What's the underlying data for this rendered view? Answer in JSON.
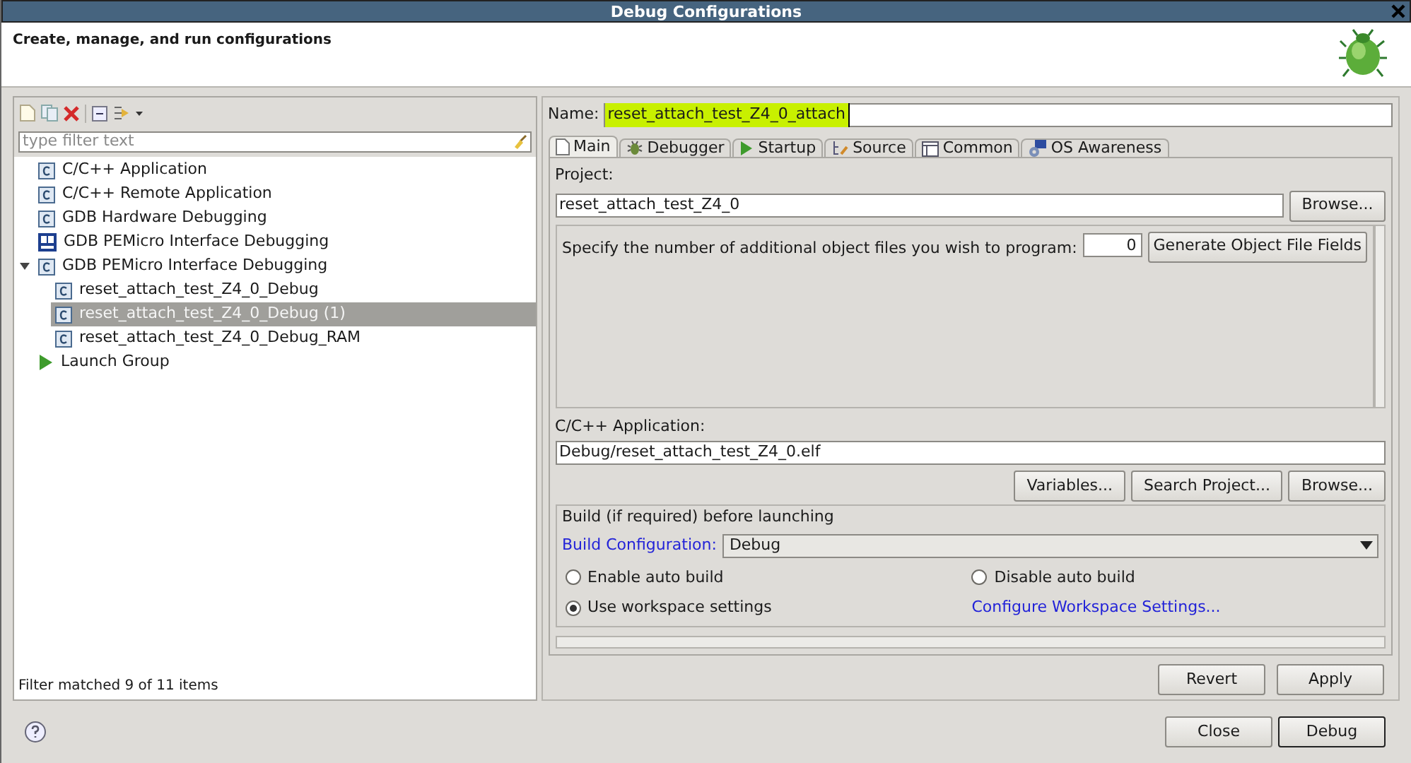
{
  "window": {
    "title": "Debug Configurations"
  },
  "header": {
    "title": "Create, manage, and run configurations"
  },
  "filter": {
    "placeholder": "type filter text"
  },
  "tree": [
    {
      "label": "C/C++ Application",
      "kind": "c",
      "selected": false
    },
    {
      "label": "C/C++ Remote Application",
      "kind": "c",
      "selected": false
    },
    {
      "label": "GDB Hardware Debugging",
      "kind": "c",
      "selected": false
    },
    {
      "label": "GDB PEMicro Interface Debugging",
      "kind": "pe",
      "selected": false
    },
    {
      "label": "GDB PEMicro Interface Debugging",
      "kind": "c",
      "selected": false,
      "expanded": true,
      "children": [
        {
          "label": "reset_attach_test_Z4_0_Debug",
          "kind": "c",
          "selected": false
        },
        {
          "label": "reset_attach_test_Z4_0_Debug (1)",
          "kind": "c",
          "selected": true
        },
        {
          "label": "reset_attach_test_Z4_0_Debug_RAM",
          "kind": "c",
          "selected": false
        }
      ]
    },
    {
      "label": "Launch Group",
      "kind": "launch",
      "selected": false
    }
  ],
  "filter_status": "Filter matched 9 of 11 items",
  "name": {
    "label": "Name:",
    "value": "reset_attach_test_Z4_0_attach"
  },
  "tabs": [
    {
      "label": "Main",
      "kind": "main",
      "selected": true
    },
    {
      "label": "Debugger",
      "kind": "debugger",
      "selected": false
    },
    {
      "label": "Startup",
      "kind": "startup",
      "selected": false
    },
    {
      "label": "Source",
      "kind": "source",
      "selected": false
    },
    {
      "label": "Common",
      "kind": "common",
      "selected": false
    },
    {
      "label": "OS Awareness",
      "kind": "os",
      "selected": false
    }
  ],
  "project": {
    "label": "Project:",
    "value": "reset_attach_test_Z4_0",
    "browse": "Browse..."
  },
  "object_files": {
    "label": "Specify the number of additional object files you wish to program:",
    "value": "0",
    "button": "Generate Object File Fields"
  },
  "application": {
    "label": "C/C++ Application:",
    "value": "Debug/reset_attach_test_Z4_0.elf",
    "buttons": [
      "Variables...",
      "Search Project...",
      "Browse..."
    ]
  },
  "build": {
    "title": "Build (if required) before launching",
    "config_label": "Build Configuration:",
    "config_value": "Debug",
    "options": [
      {
        "label": "Enable auto build",
        "selected": false
      },
      {
        "label": "Disable auto build",
        "selected": false
      },
      {
        "label": "Use workspace settings",
        "selected": true
      }
    ],
    "link": "Configure Workspace Settings..."
  },
  "panel_buttons": [
    "Revert",
    "Apply"
  ],
  "dialog_buttons": [
    "Close",
    "Debug"
  ]
}
